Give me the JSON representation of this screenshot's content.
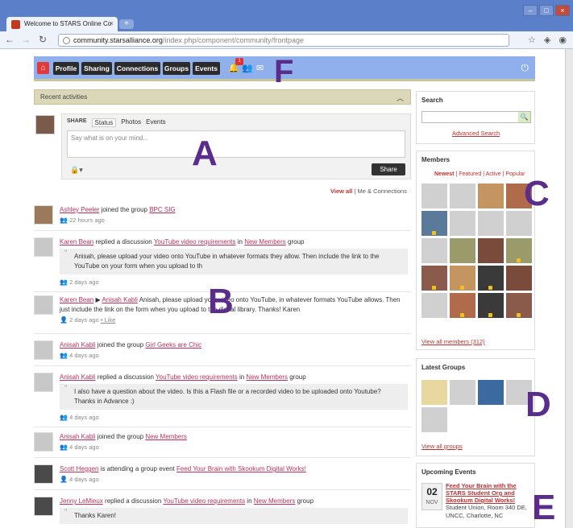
{
  "browser": {
    "tab_title": "Welcome to STARS Online Co",
    "url_host": "community.starsalliance.org",
    "url_path": "/index.php/component/community/frontpage"
  },
  "nav": {
    "tabs": [
      "Profile",
      "Sharing",
      "Connections",
      "Groups",
      "Events"
    ],
    "notif_count": "1"
  },
  "labels": {
    "a": "A",
    "b": "B",
    "c": "C",
    "d": "D",
    "e": "E",
    "f": "F"
  },
  "recent": {
    "title": "Recent activities"
  },
  "share": {
    "label": "SHARE",
    "tabs": [
      "Status",
      "Photos",
      "Events"
    ],
    "placeholder": "Say what is on your mind...",
    "button": "Share"
  },
  "filters": {
    "all": "View all",
    "mine": "Me & Connections",
    "sep": "|"
  },
  "activities": [
    {
      "actor": "Ashley Peeler",
      "text": " joined the group ",
      "target": "BPC SIG",
      "time": "22 hours ago"
    },
    {
      "actor": "Karen Bean",
      "text": " replied a discussion ",
      "target": "YouTube video requirements",
      "in": " in ",
      "group": "New Members",
      "suffix": " group",
      "quote": "Anisah, please upload your video onto YouTube in whatever formats they allow. Then include the link to the YouTube on your form when you upload to th",
      "time": "2 days ago"
    },
    {
      "actor": "Karen Bean",
      "arrow": " ▶ ",
      "target": "Anisah Kabli",
      "text": " Anisah, please upload your video onto YouTube, in whatever formats YouTube allows. Then just include the link on the form when you upload to the digital library. Thanks! Karen",
      "time": "2 days ago",
      "like": "• Like"
    },
    {
      "actor": "Anisah Kabli",
      "text": " joined the group ",
      "target": "Girl Geeks are Chic",
      "time": "4 days ago"
    },
    {
      "actor": "Anisah Kabli",
      "text": " replied a discussion ",
      "target": "YouTube video requirements",
      "in": " in ",
      "group": "New Members",
      "suffix": " group",
      "quote": "I also have a question about the video. Is this a Flash file or a recorded video to be uploaded onto Youtube? Thanks in Advance :)",
      "time": "4 days ago"
    },
    {
      "actor": "Anisah Kabli",
      "text": " joined the group ",
      "target": "New Members",
      "time": "4 days ago"
    },
    {
      "actor": "Scott Heggen",
      "text": " is attending a group event ",
      "target": "Feed Your Brain with Skookum Digital Works!",
      "time": "4 days ago"
    },
    {
      "actor": "Jenny LeMieux",
      "text": " replied a discussion ",
      "target": "YouTube video requirements",
      "in": " in ",
      "group": "New Members",
      "suffix": " group",
      "quote": "Thanks Karen!"
    }
  ],
  "sidebar": {
    "search": {
      "title": "Search",
      "advanced": "Advanced Search"
    },
    "members": {
      "title": "Members",
      "tabs": {
        "newest": "Newest",
        "featured": "Featured",
        "active": "Active",
        "popular": "Popular"
      },
      "view_all": "View all members (312)"
    },
    "groups": {
      "title": "Latest Groups",
      "view_all": "View all groups"
    },
    "events": {
      "title": "Upcoming Events",
      "day": "02",
      "month": "NOV",
      "name": "Feed Your Brain with the STARS Student Org and Skookum Digital Works!",
      "location": "Student Union, Room 340 DE, UNCC, Charlotte, NC"
    }
  }
}
